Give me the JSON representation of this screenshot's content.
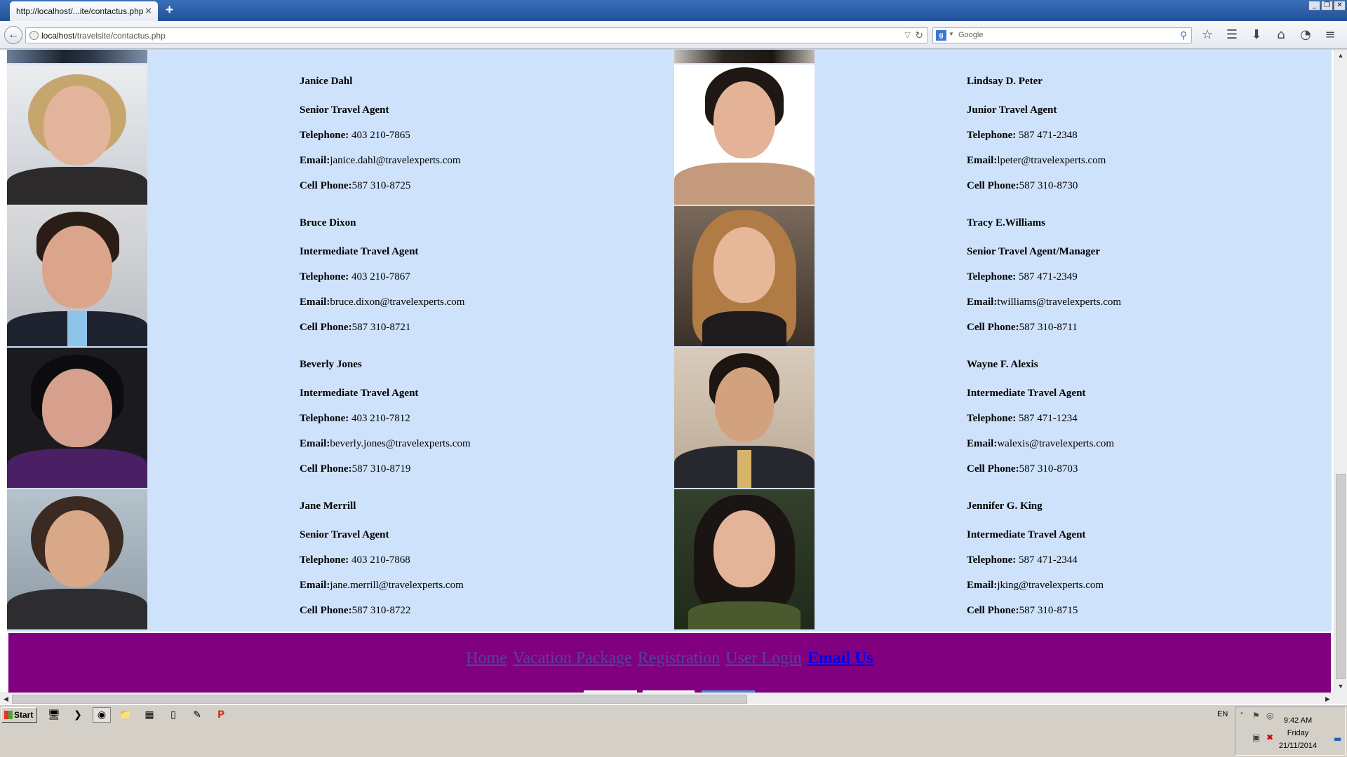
{
  "browser": {
    "tab_title": "http://localhost/...ite/contactus.php",
    "tab_close": "✕",
    "new_tab": "+",
    "url_host": "localhost",
    "url_path": "/travelsite/contactus.php",
    "search_placeholder": "Google",
    "window_controls": [
      "_",
      "❐",
      "✕"
    ]
  },
  "agents_left": [
    {
      "name": "Janice Dahl",
      "position": "Senior Travel Agent",
      "telephone_label": "Telephone:",
      "telephone": " 403 210-7865",
      "email_label": "Email:",
      "email": "janice.dahl@travelexperts.com",
      "cell_label": "Cell Phone:",
      "cell": "587 310-8725"
    },
    {
      "name": "Bruce Dixon",
      "position": "Intermediate Travel Agent",
      "telephone_label": "Telephone:",
      "telephone": " 403 210-7867",
      "email_label": "Email:",
      "email": "bruce.dixon@travelexperts.com",
      "cell_label": "Cell Phone:",
      "cell": "587 310-8721"
    },
    {
      "name": "Beverly Jones",
      "position": "Intermediate Travel Agent",
      "telephone_label": "Telephone:",
      "telephone": " 403 210-7812",
      "email_label": "Email:",
      "email": "beverly.jones@travelexperts.com",
      "cell_label": "Cell Phone:",
      "cell": "587 310-8719"
    },
    {
      "name": "Jane Merrill",
      "position": "Senior Travel Agent",
      "telephone_label": "Telephone:",
      "telephone": " 403 210-7868",
      "email_label": "Email:",
      "email": "jane.merrill@travelexperts.com",
      "cell_label": "Cell Phone:",
      "cell": "587 310-8722"
    }
  ],
  "agents_right": [
    {
      "name": "Lindsay D. Peter",
      "position": "Junior Travel Agent",
      "telephone_label": "Telephone:",
      "telephone": " 587 471-2348",
      "email_label": "Email:",
      "email": "lpeter@travelexperts.com",
      "cell_label": "Cell Phone:",
      "cell": "587 310-8730"
    },
    {
      "name": "Tracy E.Williams",
      "position": "Senior Travel Agent/Manager",
      "telephone_label": "Telephone:",
      "telephone": " 587 471-2349",
      "email_label": "Email:",
      "email": "twilliams@travelexperts.com",
      "cell_label": "Cell Phone:",
      "cell": "587 310-8711"
    },
    {
      "name": "Wayne F. Alexis",
      "position": "Intermediate Travel Agent",
      "telephone_label": "Telephone:",
      "telephone": " 587 471-1234",
      "email_label": "Email:",
      "email": "walexis@travelexperts.com",
      "cell_label": "Cell Phone:",
      "cell": "587 310-8703"
    },
    {
      "name": "Jennifer G. King",
      "position": "Intermediate Travel Agent",
      "telephone_label": "Telephone:",
      "telephone": " 587 471-2344",
      "email_label": "Email:",
      "email": "jking@travelexperts.com",
      "cell_label": "Cell Phone:",
      "cell": "587 310-8715"
    }
  ],
  "footer": {
    "links": [
      "Home",
      "Vacation Package",
      "Registration",
      "User Login",
      "Email Us"
    ],
    "active_link": "Email Us",
    "background": "#800080"
  },
  "page": {
    "background": "#cfe2fb"
  },
  "taskbar": {
    "start_label": "Start",
    "language": "EN",
    "time": "9:42 AM",
    "day": "Friday",
    "date": "21/11/2014"
  }
}
